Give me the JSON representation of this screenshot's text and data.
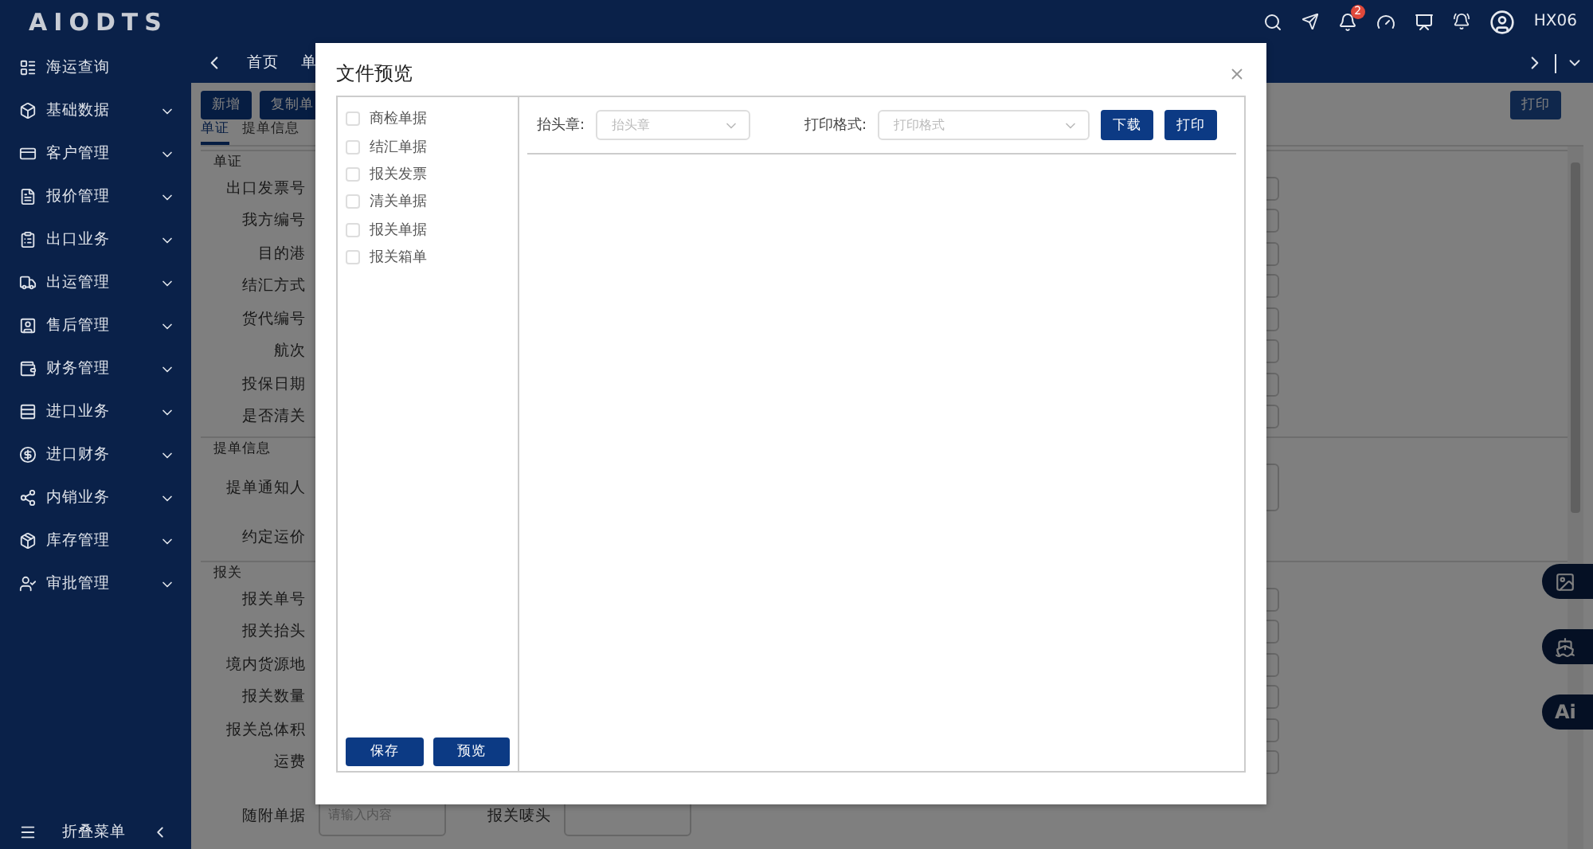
{
  "header": {
    "logo": "AIODTS",
    "notification_badge": "2",
    "user": "HX06"
  },
  "sidebar": {
    "items": [
      {
        "label": "海运查询",
        "kind": "link"
      },
      {
        "label": "基础数据",
        "kind": "group"
      },
      {
        "label": "客户管理",
        "kind": "group"
      },
      {
        "label": "报价管理",
        "kind": "group"
      },
      {
        "label": "出口业务",
        "kind": "group"
      },
      {
        "label": "出运管理",
        "kind": "group"
      },
      {
        "label": "售后管理",
        "kind": "group"
      },
      {
        "label": "财务管理",
        "kind": "group"
      },
      {
        "label": "进口业务",
        "kind": "group"
      },
      {
        "label": "进口财务",
        "kind": "group"
      },
      {
        "label": "内销业务",
        "kind": "group"
      },
      {
        "label": "库存管理",
        "kind": "group"
      },
      {
        "label": "审批管理",
        "kind": "group"
      }
    ],
    "collapse_label": "折叠菜单"
  },
  "page_tabs": [
    "首页",
    "单"
  ],
  "toolbar": {
    "buttons": [
      "新增",
      "复制单"
    ],
    "print_button": "打印"
  },
  "form_tabs": [
    {
      "label": "单证",
      "selected": true
    },
    {
      "label": "提单信息",
      "selected": false
    }
  ],
  "sections": [
    {
      "title": "单证",
      "fields": [
        {
          "label": "出口发票号",
          "kind": "input"
        },
        {
          "label": "我方编号",
          "kind": "input"
        },
        {
          "label": "目的港",
          "kind": "input"
        },
        {
          "label": "结汇方式",
          "kind": "input"
        },
        {
          "label": "货代编号",
          "kind": "input"
        },
        {
          "label": "航次",
          "kind": "input"
        },
        {
          "label": "投保日期",
          "kind": "input"
        },
        {
          "label": "是否清关",
          "kind": "input"
        }
      ]
    },
    {
      "title": "提单信息",
      "fields": [
        {
          "label": "提单通知人",
          "kind": "textarea"
        },
        {
          "label": "约定运价",
          "kind": "blank"
        }
      ]
    },
    {
      "title": "报关",
      "fields": [
        {
          "label": "报关单号",
          "kind": "input"
        },
        {
          "label": "报关抬头",
          "kind": "input"
        },
        {
          "label": "境内货源地",
          "kind": "input"
        },
        {
          "label": "报关数量",
          "kind": "input"
        },
        {
          "label": "报关总体积",
          "kind": "input"
        },
        {
          "label": "运费",
          "kind": "input"
        }
      ]
    }
  ],
  "bottom_row": {
    "attachments_label": "随附单据",
    "attachments_placeholder": "请输入内容",
    "marks_label": "报关唛头"
  },
  "float_buttons": [
    {
      "kind": "image"
    },
    {
      "kind": "ship"
    },
    {
      "kind": "text",
      "label": "Ai"
    }
  ],
  "modal": {
    "title": "文件预览",
    "documents": [
      {
        "label": "商检单据",
        "checked": false
      },
      {
        "label": "结汇单据",
        "checked": false
      },
      {
        "label": "报关发票",
        "checked": false
      },
      {
        "label": "清关单据",
        "checked": false
      },
      {
        "label": "报关单据",
        "checked": false
      },
      {
        "label": "报关箱单",
        "checked": false
      }
    ],
    "save": "保存",
    "preview": "预览",
    "stamp": {
      "label": "抬头章:",
      "placeholder": "抬头章"
    },
    "format": {
      "label": "打印格式:",
      "placeholder": "打印格式"
    },
    "download": "下载",
    "print": "打印"
  }
}
